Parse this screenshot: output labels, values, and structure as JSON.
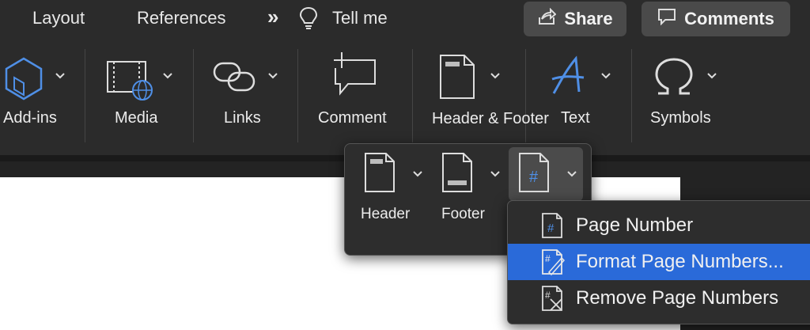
{
  "tabs": {
    "layout": "Layout",
    "references": "References",
    "more": "»",
    "tell_me": "Tell me"
  },
  "top_buttons": {
    "share": "Share",
    "comments": "Comments"
  },
  "ribbon": {
    "addins": "Add-ins",
    "media": "Media",
    "links": "Links",
    "comment": "Comment",
    "header_footer": "Header & Footer",
    "text": "Text",
    "symbols": "Symbols"
  },
  "popover": {
    "header": "Header",
    "footer": "Footer"
  },
  "menu": {
    "items": [
      {
        "label": "Page Number",
        "selected": false
      },
      {
        "label": "Format Page Numbers...",
        "selected": true
      },
      {
        "label": "Remove Page Numbers",
        "selected": false
      }
    ]
  },
  "colors": {
    "background": "#2b2b2b",
    "button": "#4a4a4a",
    "selection": "#2a6ad9",
    "icon_blue": "#4f8fe6"
  },
  "icons": [
    "lightbulb-icon",
    "share-icon",
    "comment-bubble-icon",
    "hexagon-addins-icon",
    "media-film-icon",
    "links-chain-icon",
    "new-comment-icon",
    "header-footer-icon",
    "text-a-icon",
    "omega-symbol-icon",
    "chevron-down-icon",
    "page-number-icon",
    "format-page-numbers-icon",
    "remove-page-numbers-icon"
  ]
}
